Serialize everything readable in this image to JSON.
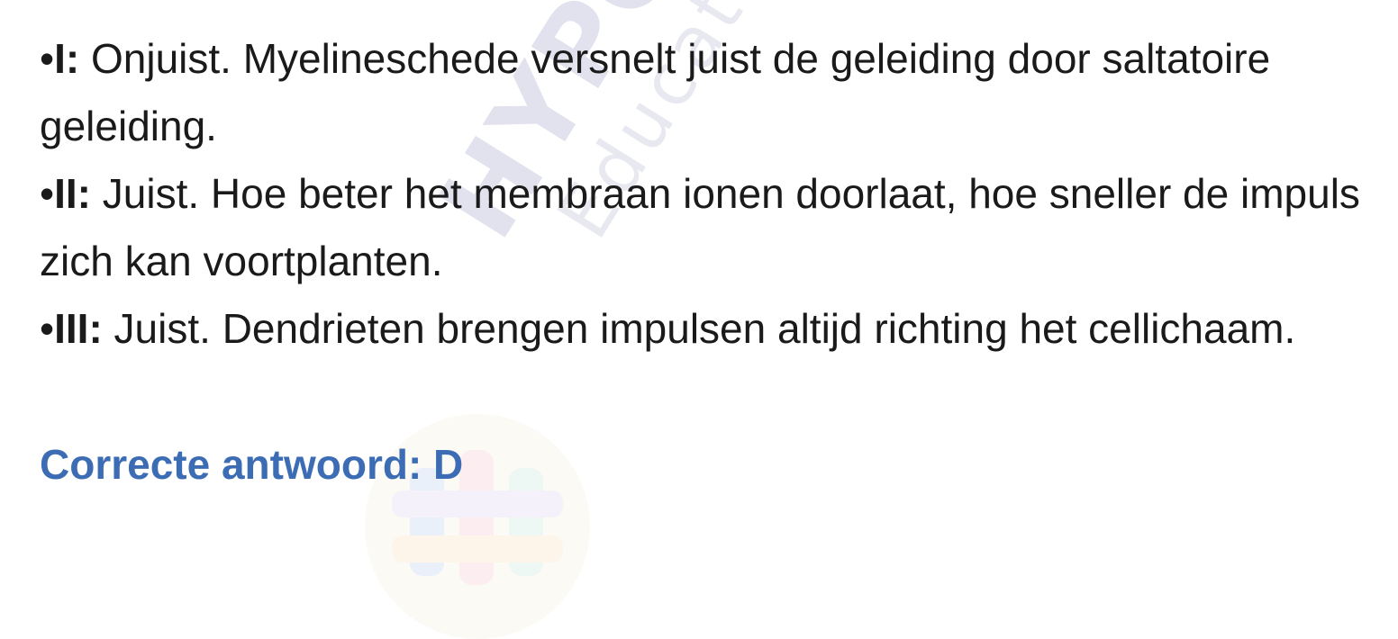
{
  "statements": [
    {
      "bullet": "•",
      "lead": "I:",
      "text": " Onjuist. Myelineschede versnelt juist de geleiding door saltatoire geleiding."
    },
    {
      "bullet": "•",
      "lead": "II:",
      "text": " Juist. Hoe beter het membraan ionen doorlaat, hoe sneller de impuls zich kan voortplanten."
    },
    {
      "bullet": "•",
      "lead": "III:",
      "text": " Juist. Dendrieten brengen impulsen altijd richting het cellichaam."
    }
  ],
  "answer": "Correcte antwoord: D",
  "watermark": {
    "brand": "HYPOTENUSE",
    "subtitle": "Education Center"
  },
  "colors": {
    "text": "#1a1a1a",
    "answer": "#3c6db4",
    "watermark": "#c9cbe0"
  }
}
